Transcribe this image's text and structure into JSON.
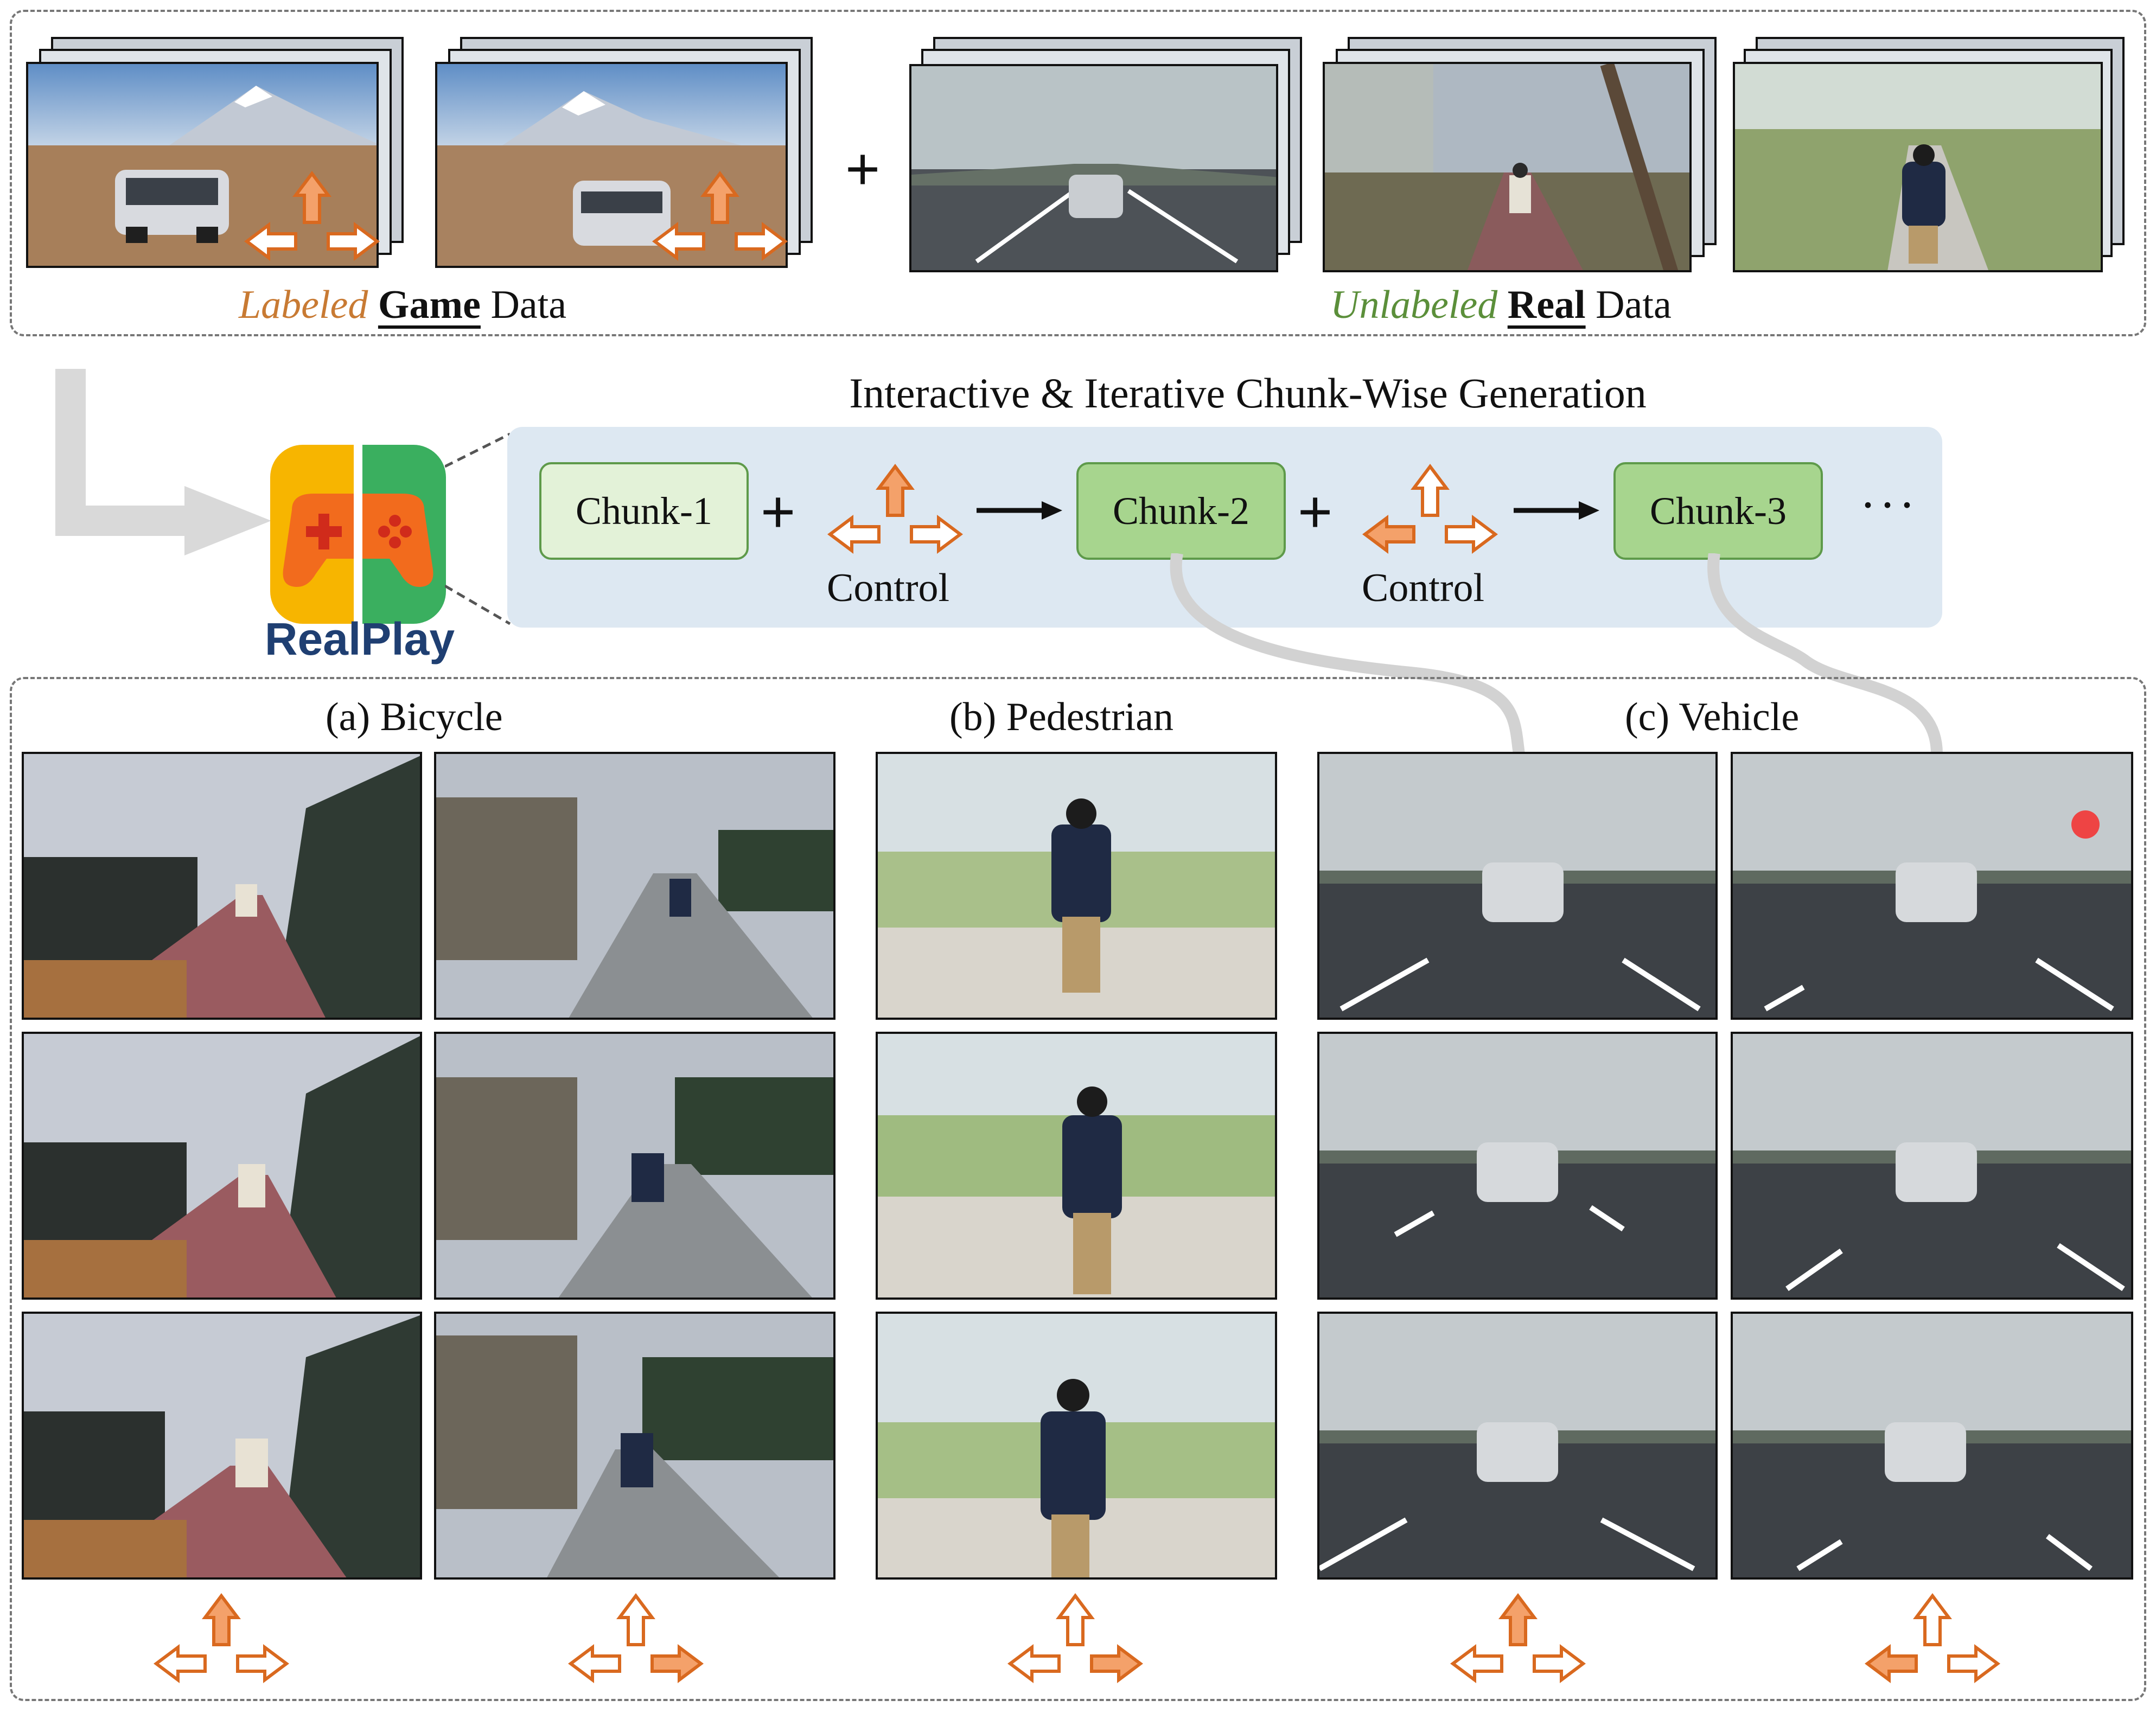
{
  "top": {
    "game_label": {
      "italic": "Labeled",
      "bold": "Game",
      "rest": "Data"
    },
    "plus": "+",
    "real_label": {
      "italic": "Unlabeled",
      "bold": "Real",
      "rest": "Data"
    }
  },
  "logo": {
    "text": "RealPlay"
  },
  "flow": {
    "title": "Interactive & Iterative Chunk-Wise Generation",
    "chunks": [
      "Chunk-1",
      "Chunk-2",
      "Chunk-3"
    ],
    "plus": "+",
    "control_label": "Control",
    "ellipsis": "···"
  },
  "columns": {
    "bicycle": "(a) Bicycle",
    "pedestrian": "(b) Pedestrian",
    "vehicle": "(c) Vehicle"
  },
  "colors": {
    "arrow_stroke": "#d9691f",
    "arrow_fill": "#f4a16a",
    "chunk_border": "#5e9a4a",
    "panel_bg": "#dde8f2",
    "logo_yellow": "#f7b500",
    "logo_green": "#3aaf5f",
    "logo_orange": "#f26b1d"
  },
  "controls": {
    "game_1_active": "up",
    "game_2_active": "up",
    "flow_control_1_active": "up",
    "flow_control_2_active": "left",
    "bicycle_left_active": "up",
    "bicycle_right_active": "right",
    "pedestrian_active": "right",
    "vehicle_left_active": "up",
    "vehicle_right_active": "left"
  }
}
